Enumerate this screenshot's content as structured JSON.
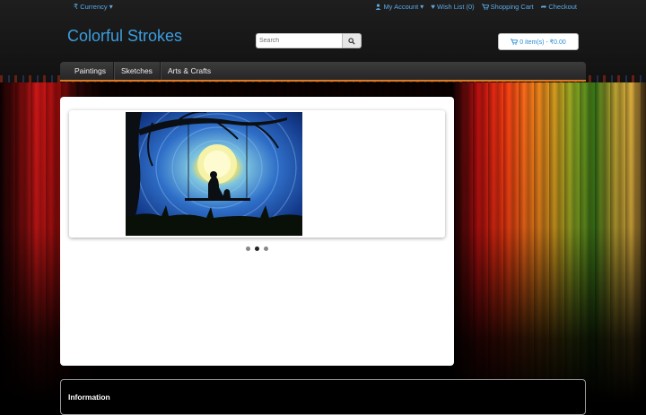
{
  "topbar": {
    "currency_label": "Currency",
    "my_account_label": "My Account",
    "wishlist_label": "Wish List (0)",
    "shopping_cart_label": "Shopping Cart",
    "checkout_label": "Checkout"
  },
  "header": {
    "logo_text": "Colorful Strokes",
    "search_placeholder": "Search",
    "cart_label": "0 item(s) - ₹0.00"
  },
  "menu": {
    "items": [
      {
        "label": "Paintings"
      },
      {
        "label": "Sketches"
      },
      {
        "label": "Arts & Crafts"
      }
    ]
  },
  "slideshow": {
    "dot_count": 3,
    "active_index": 1
  },
  "footer": {
    "information_heading": "Information"
  },
  "colors": {
    "link": "#5aa9e6",
    "logo": "#3c9ee0",
    "menu_underline": "#e07a20"
  }
}
